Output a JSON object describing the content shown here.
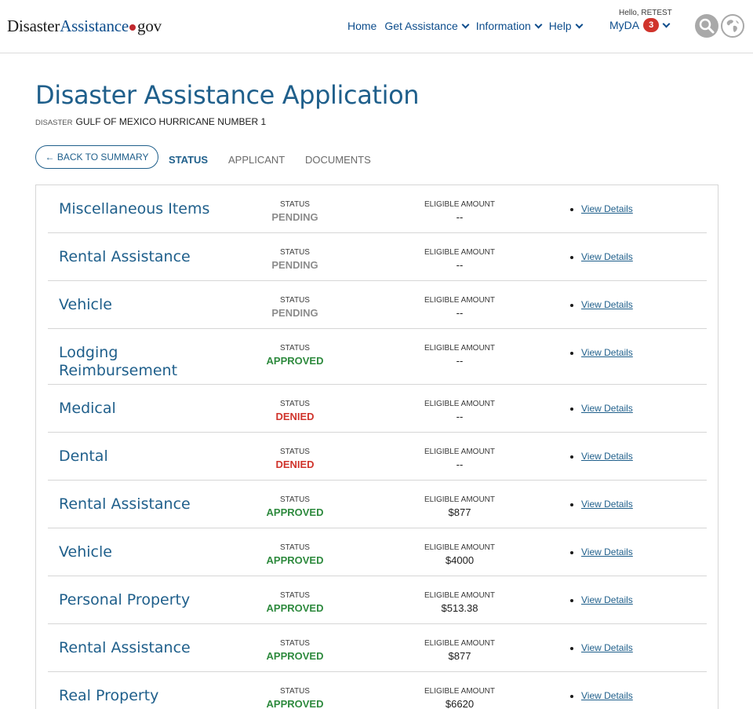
{
  "header": {
    "logo_part1": "Disaster",
    "logo_part2": "Assistance",
    "logo_part3": "gov",
    "nav": {
      "home": "Home",
      "get_assistance": "Get Assistance",
      "information": "Information",
      "help": "Help"
    },
    "account": {
      "greeting": "Hello, RETEST",
      "label": "MyDA",
      "notification_count": "3"
    },
    "icons": [
      "search-icon",
      "globe-icon",
      "chevron-down-icon"
    ]
  },
  "page": {
    "title": "Disaster Assistance Application",
    "disaster_label": "DISASTER",
    "disaster_name": "GULF OF MEXICO HURRICANE NUMBER 1"
  },
  "tabs": {
    "back": "← BACK TO SUMMARY",
    "status": "STATUS",
    "applicant": "APPLICANT",
    "documents": "DOCUMENTS"
  },
  "colors": {
    "brand_blue": "#1f5f8b",
    "approved": "#2e8a3e",
    "denied": "#d0342c",
    "pending": "#8c8c8c"
  },
  "table": {
    "status_label": "STATUS",
    "amount_label": "ELIGIBLE AMOUNT",
    "link_label": "View Details",
    "rows": [
      {
        "name": "Miscellaneous Items",
        "status": "PENDING",
        "amount": "--"
      },
      {
        "name": "Rental Assistance",
        "status": "PENDING",
        "amount": "--"
      },
      {
        "name": "Vehicle",
        "status": "PENDING",
        "amount": "--"
      },
      {
        "name": "Lodging Reimbursement",
        "status": "APPROVED",
        "amount": "--"
      },
      {
        "name": "Medical",
        "status": "DENIED",
        "amount": "--"
      },
      {
        "name": "Dental",
        "status": "DENIED",
        "amount": "--"
      },
      {
        "name": "Rental Assistance",
        "status": "APPROVED",
        "amount": "$877"
      },
      {
        "name": "Vehicle",
        "status": "APPROVED",
        "amount": "$4000"
      },
      {
        "name": "Personal Property",
        "status": "APPROVED",
        "amount": "$513.38"
      },
      {
        "name": "Rental Assistance",
        "status": "APPROVED",
        "amount": "$877"
      },
      {
        "name": "Real Property",
        "status": "APPROVED",
        "amount": "$6620"
      }
    ]
  }
}
